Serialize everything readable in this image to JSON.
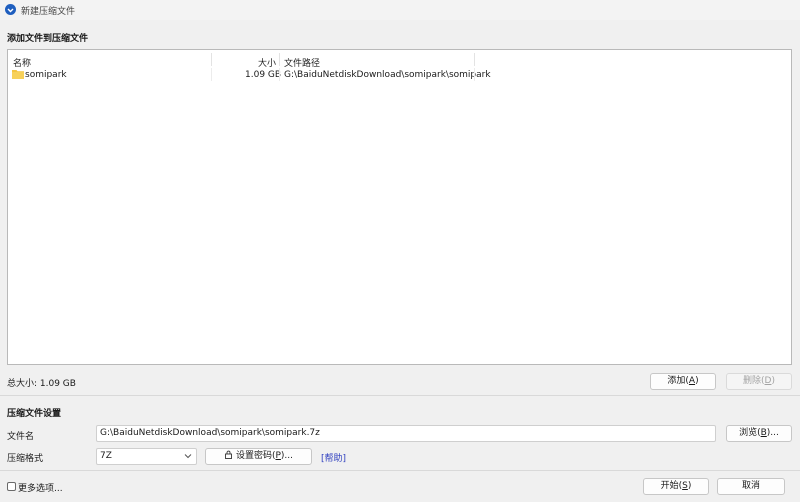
{
  "window": {
    "title": "新建压缩文件"
  },
  "files_section": {
    "heading": "添加文件到压缩文件",
    "columns": {
      "name": "名称",
      "size": "大小",
      "path": "文件路径"
    },
    "rows": [
      {
        "name": "somipark",
        "size": "1.09 GB",
        "path": "G:\\BaiduNetdiskDownload\\somipark\\somipark",
        "icon": "folder-icon"
      }
    ],
    "total_size": "总大小: 1.09 GB",
    "add_button": {
      "text": "添加(",
      "key": "A",
      "close": ")"
    },
    "delete_button": {
      "text": "删除(",
      "key": "D",
      "close": ")"
    }
  },
  "settings_section": {
    "heading": "压缩文件设置",
    "filename_label": "文件名",
    "filename_value": "G:\\BaiduNetdiskDownload\\somipark\\somipark.7z",
    "browse_button": {
      "text": "浏览(",
      "key": "B",
      "close": ")..."
    },
    "format_label": "压缩格式",
    "format_value": "7Z",
    "password_button": {
      "text": "设置密码(",
      "key": "P",
      "close": ")..."
    },
    "help_link": "[帮助]"
  },
  "footer": {
    "more_options": "更多选项...",
    "start_button": {
      "text": "开始(",
      "key": "S",
      "close": ")"
    },
    "cancel_button": "取消"
  },
  "colors": {
    "folder": "#f4c542",
    "app_icon": "#1f5fbf",
    "link": "#2d3dbf"
  }
}
